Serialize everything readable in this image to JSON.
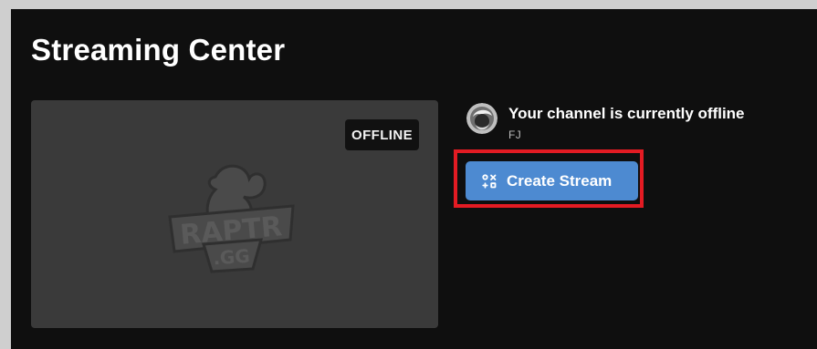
{
  "page": {
    "title": "Streaming Center"
  },
  "preview": {
    "status_badge": "OFFLINE",
    "logo_icon": "raptr-gg-logo"
  },
  "channel": {
    "avatar_icon": "avatar",
    "status": "Your channel is currently offline",
    "name": "FJ"
  },
  "actions": {
    "create_stream_label": "Create Stream",
    "create_stream_icon": "stream-grid-icon"
  },
  "colors": {
    "app_background": "#0f0f0f",
    "preview_background": "#3a3a3a",
    "button_background": "#4d8ad1",
    "highlight": "#e31b23",
    "text_primary": "#ffffff",
    "text_secondary": "#bdbdbd"
  }
}
